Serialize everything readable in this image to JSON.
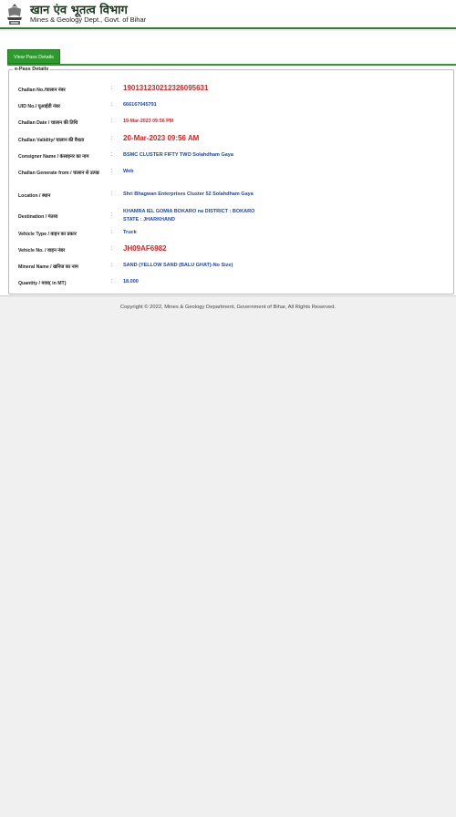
{
  "header": {
    "title_hindi": "खान एंव भूतत्व विभाग",
    "title_en": "Mines & Geology Dept., Govt. of Bihar"
  },
  "tab": {
    "label": "View Pass Details"
  },
  "epass": {
    "legend": "e-Pass Details",
    "rows": [
      {
        "label": "Challan No./चालान नंबर",
        "value": "190131230212326095631"
      },
      {
        "label": "UID No./ यूआईडी नंबर",
        "value": "666167045791"
      },
      {
        "label": "Challan Date / चालान की तिथि",
        "value": "19-Mar-2023 09:56 PM"
      },
      {
        "label": "Challan Validity/ चालान की वैधता",
        "value": "20-Mar-2023 09:56 AM"
      },
      {
        "label": "Consigner Name / कंसाइनर का नाम",
        "value": "BSMC CLUSTER FIFTY TWO Solahdham Gaya"
      },
      {
        "label": "Challan Generate from / चालान से उत्पन्न",
        "value": "Web"
      },
      {
        "label": "Location / स्थान",
        "value": "Shri Bhagwan Enterprises Cluster 52 Solahdham Gaya"
      },
      {
        "label": "Destination / गंतव्य",
        "value_line1": "KHAMRA IEL GOMIA BOKARO na DISTRICT : BOKARO",
        "value_line2": "STATE : JHARKHAND"
      },
      {
        "label": "Vehicle Type / वाहन का प्रकार",
        "value": "Truck"
      },
      {
        "label": "Vehicle No. / वाहन नंबर",
        "value": "JH09AF6982"
      },
      {
        "label": "Mineral Name / खनिज का नाम",
        "value": "SAND (YELLOW SAND (BALU GHAT)-No Size)"
      },
      {
        "label": "Quantity / मात्रा( in MT)",
        "value": "18.000"
      }
    ]
  },
  "footer": {
    "copyright": "Copyright © 2022, Mines & Geology Department, Government of Bihar, All Rights Reserved."
  },
  "colors": {
    "brand_green": "#2e9a2e",
    "value_blue": "#1a47b8",
    "alert_red": "#e02020"
  }
}
